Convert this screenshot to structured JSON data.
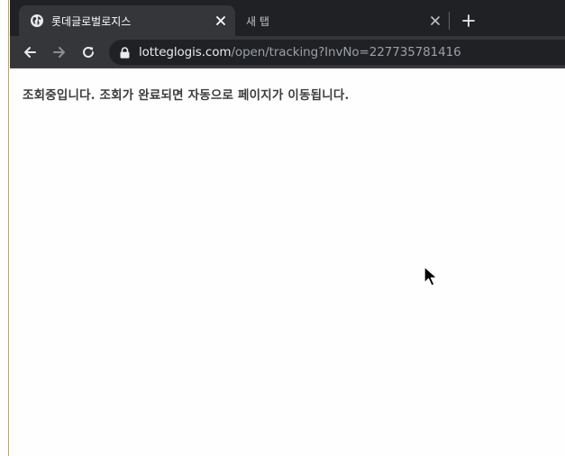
{
  "tabs": [
    {
      "title": "롯데글로벌로지스",
      "active": true
    },
    {
      "title": "새 탭",
      "active": false
    }
  ],
  "toolbar": {
    "url_host": "lotteglogis.com",
    "url_path": "/open/tracking?InvNo=227735781416"
  },
  "content": {
    "message": "조회중입니다. 조회가 완료되면 자동으로 페이지가 이동됩니다."
  },
  "colors": {
    "tabstrip": "#202124",
    "toolbar": "#35363a",
    "omnibox": "#202124",
    "text_primary": "#e8eaed",
    "text_secondary": "#9aa0a6",
    "page_text": "#3c3c3c"
  }
}
